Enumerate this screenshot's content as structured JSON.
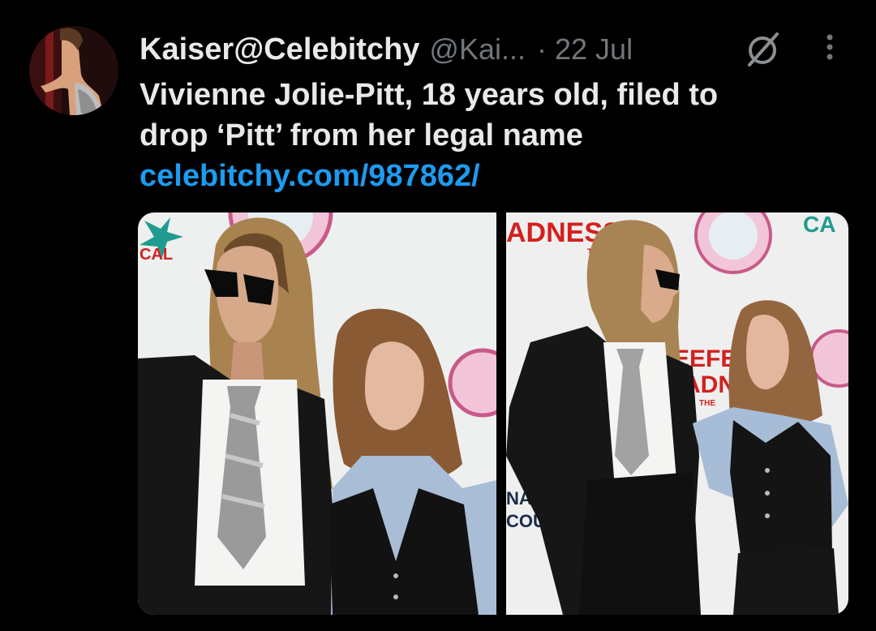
{
  "tweet": {
    "display_name": "Kaiser@Celebitchy",
    "handle": "@Kai...",
    "separator": "·",
    "date": "22 Jul",
    "text_line1": "Vivienne Jolie-Pitt, 18 years old, filed to",
    "text_line2": "drop ‘Pitt’ from her legal name",
    "link": "celebitchy.com/987862/",
    "icons": {
      "avatar": "avatar",
      "grok": "grok-icon",
      "more": "more-icon"
    },
    "colors": {
      "background": "#000000",
      "primary_text": "#e7e9ea",
      "secondary_text": "#71767b",
      "link": "#1d9bf0"
    }
  },
  "media": {
    "left_photo": {
      "signage": [
        "CAL"
      ]
    },
    "right_photo": {
      "signage": [
        "ADNESS",
        "THE",
        "EEFER",
        "ADNESS",
        "THE",
        "NAB",
        "COU",
        "CA"
      ]
    }
  }
}
